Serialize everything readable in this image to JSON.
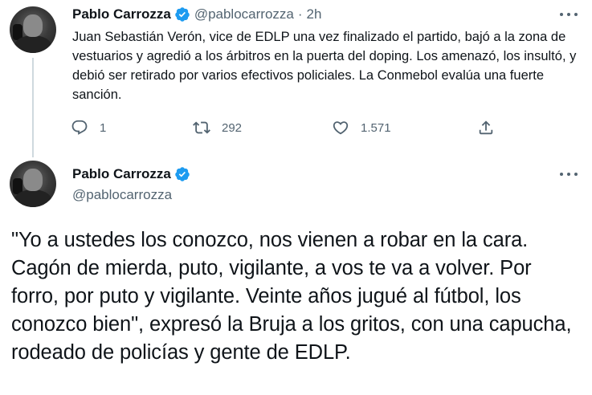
{
  "reply_tweet": {
    "author_name": "Pablo Carrozza",
    "handle": "@pablocarrozza",
    "separator": "·",
    "time": "2h",
    "text": "Juan Sebastián Verón, vice de EDLP una vez finalizado el partido, bajó a la zona de vestuarios y agredió a los árbitros en la puerta del doping. Los amenazó, los insultó, y debió ser retirado por varios efectivos policiales. La Conmebol evalúa una fuerte sanción.",
    "replies": "1",
    "retweets": "292",
    "likes": "1.571"
  },
  "main_tweet": {
    "author_name": "Pablo Carrozza",
    "handle": "@pablocarrozza",
    "text": "\"Yo a ustedes los conozco, nos vienen a robar en la cara. Cagón de mierda, puto, vigilante, a vos te va a volver. Por forro, por puto y vigilante. Veinte años jugué al fútbol, los conozco bien\", expresó la Bruja a los gritos, con una capucha, rodeado de policías y gente de EDLP."
  },
  "colors": {
    "verified": "#1d9bf0",
    "secondary_text": "#536471",
    "primary_text": "#0f1419",
    "thread_line": "#cfd9de"
  },
  "icons": [
    "verified-badge-icon",
    "reply-icon",
    "retweet-icon",
    "like-icon",
    "share-icon",
    "more-options-icon"
  ]
}
